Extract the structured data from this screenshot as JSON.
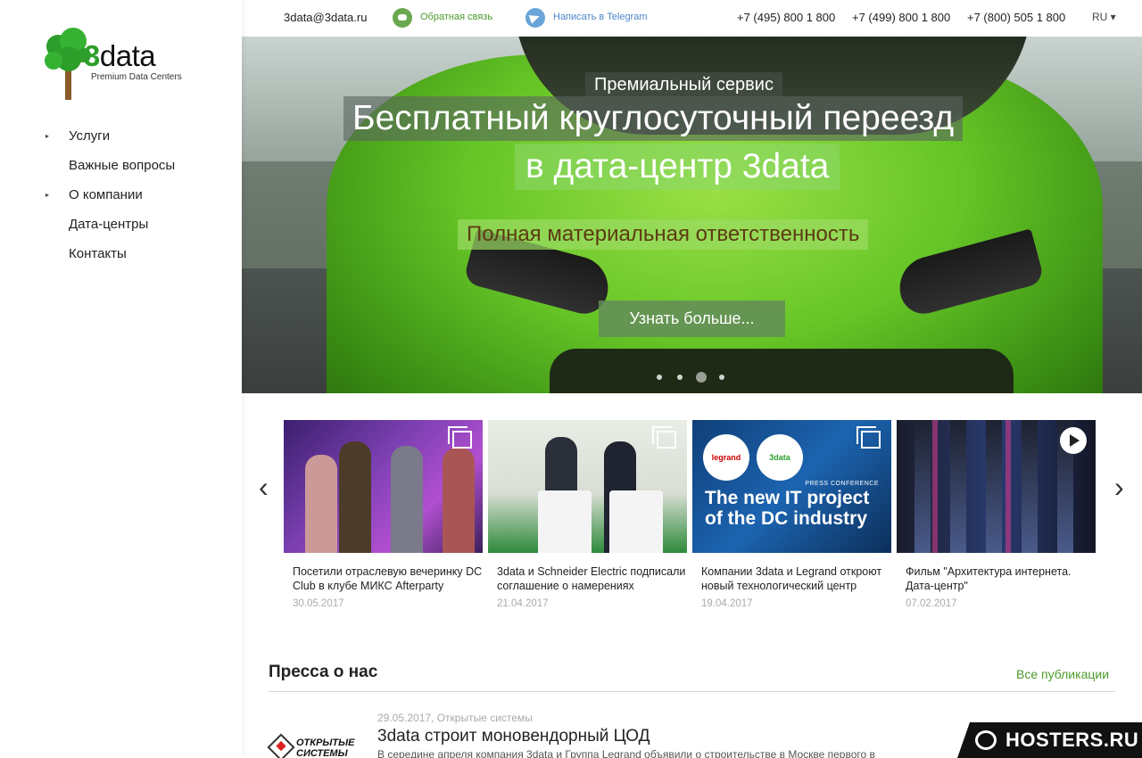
{
  "colors": {
    "accent_green": "#4c9a2a",
    "link_blue": "#4a86c6",
    "brand_green": "#2c9e2a"
  },
  "logo": {
    "brand_prefix": "3",
    "brand_rest": "data",
    "tagline": "Premium Data Centers"
  },
  "sidebar": {
    "items": [
      {
        "label": "Услуги",
        "has_submenu": true
      },
      {
        "label": "Важные вопросы",
        "has_submenu": false
      },
      {
        "label": "О компании",
        "has_submenu": true
      },
      {
        "label": "Дата-центры",
        "has_submenu": false
      },
      {
        "label": "Контакты",
        "has_submenu": false
      }
    ]
  },
  "topbar": {
    "email": "3data@3data.ru",
    "feedback": "Обратная связь",
    "telegram": "Написать в Telegram",
    "phones": [
      "+7 (495) 800 1 800",
      "+7 (499) 800 1 800",
      "+7 (800) 505 1 800"
    ],
    "language": "RU ▾"
  },
  "hero": {
    "kicker": "Премиальный сервис",
    "line1": "Бесплатный круглосуточный переезд",
    "line2": "в дата-центр 3data",
    "subline": "Полная материальная ответственность",
    "button": "Узнать больше...",
    "slides_total": 4,
    "active_slide": 3
  },
  "news": {
    "prev_icon": "‹",
    "next_icon": "›",
    "items": [
      {
        "title": "Посетили отраслевую вечеринку DC Club в клубе МИКС Afterparty",
        "date": "30.05.2017",
        "media": "gallery-icon"
      },
      {
        "title": "3data и Schneider Electric подписали соглашение о намерениях",
        "date": "21.04.2017",
        "media": "gallery-icon"
      },
      {
        "title": "Компании 3data и Legrand откроют новый технологический центр",
        "date": "19.04.2017",
        "media": "gallery-icon",
        "thumb": {
          "badge1": "legrand",
          "badge2": "3data",
          "tag": "PRESS CONFERENCE",
          "headline": "The new IT project of the DC industry"
        }
      },
      {
        "title": "Фильм \"Архитектура интернета. Дата-центр\"",
        "date": "07.02.2017",
        "media": "play-icon"
      }
    ]
  },
  "press": {
    "title": "Пресса о нас",
    "all_link": "Все публикации",
    "items": [
      {
        "logo_text": "ОТКРЫТЫЕ СИСТЕМЫ",
        "meta": "29.05.2017, Открытые системы",
        "headline": "3data строит моновендорный ЦОД",
        "excerpt": "В середине апреля компания 3data и Группа Legrand объявили о строительстве в Москве первого в"
      }
    ]
  },
  "watermark": {
    "text": "HOSTERS.RU"
  }
}
